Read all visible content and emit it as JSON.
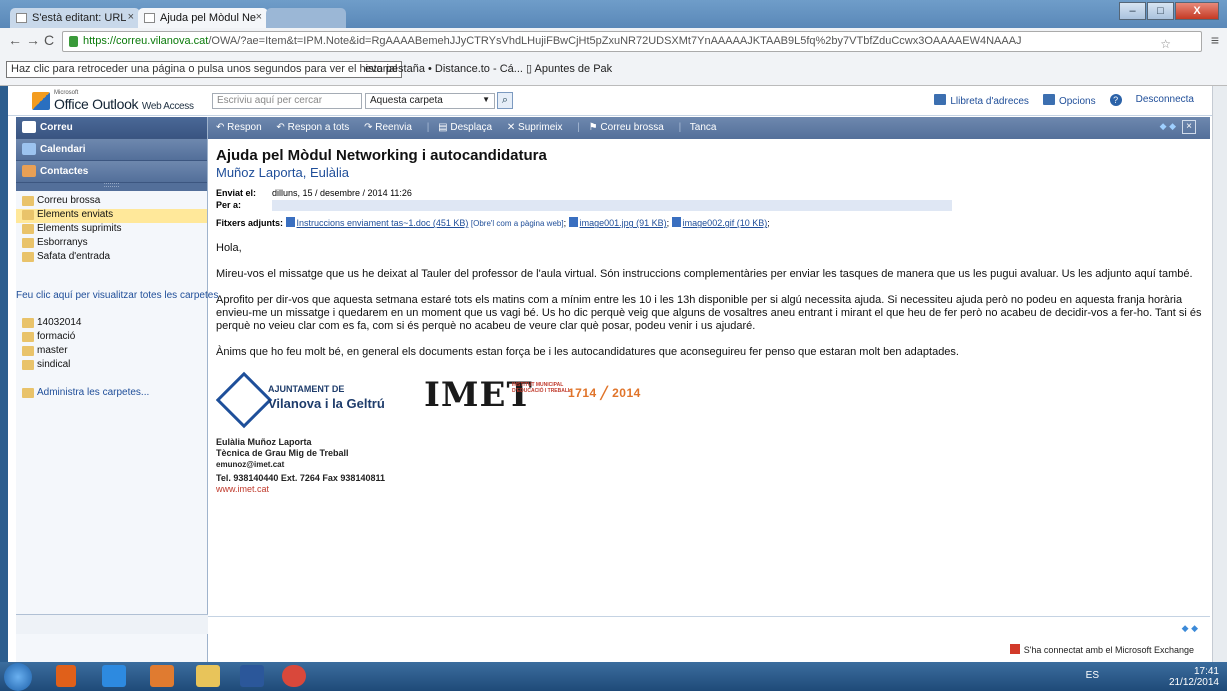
{
  "browser": {
    "tabs": [
      {
        "label": "S'està editant: URL"
      },
      {
        "label": "Ajuda pel Mòdul Ne"
      }
    ],
    "url_host": "https://correu.vilanova.cat",
    "url_path": "/OWA/?ae=Item&t=IPM.Note&id=RgAAAABemehJJyCTRYsVhdLHujiFBwCjHt5pZxuNR72UDSXMt7YnAAAAAJKTAAB9L5fq%2by7VTbfZduCcwx3OAAAAEW4NAAAJ",
    "tooltip": "Haz clic para retroceder una página o pulsa unos segundos para ver el historial",
    "bookmarks": "eva pestaña  •  Distance.to - Cá...  ▯ Apuntes de Pak"
  },
  "owa": {
    "brand_ms": "Microsoft",
    "brand_name": "Office Outlook",
    "brand_sub": "Web Access",
    "search_placeholder": "Escriviu aquí per cercar",
    "search_scope": "Aquesta carpeta",
    "header_links": {
      "address_book": "Llibreta d'adreces",
      "options": "Opcions",
      "logout": "Desconnecta"
    },
    "nav": {
      "mail": "Correu",
      "calendar": "Calendari",
      "contacts": "Contactes"
    },
    "folders": [
      {
        "label": "Correu brossa"
      },
      {
        "label": "Elements enviats"
      },
      {
        "label": "Elements suprimits"
      },
      {
        "label": "Esborranys"
      },
      {
        "label": "Safata d'entrada"
      }
    ],
    "show_all_folders": "Feu clic aquí per visualitzar totes les carpetes",
    "custom_folders": [
      {
        "label": "14032014"
      },
      {
        "label": "formació"
      },
      {
        "label": "master"
      },
      {
        "label": "sindical"
      }
    ],
    "manage_folders": "Administra les carpetes...",
    "toolbar": {
      "reply": "Respon",
      "reply_all": "Respon a tots",
      "forward": "Reenvia",
      "move": "Desplaça",
      "delete": "Suprimeix",
      "junk": "Correu brossa",
      "close": "Tanca"
    },
    "message": {
      "subject": "Ajuda pel Mòdul Networking i autocandidatura",
      "sender": "Muñoz Laporta, Eulàlia",
      "sent_label": "Enviat el:",
      "sent_value": "dilluns, 15 / desembre / 2014 11:26",
      "to_label": "Per a:",
      "attach_label": "Fitxers adjunts:",
      "attach1": "Instruccions enviament tas~1.doc (451 KB)",
      "attach1_open": "[Obre'l com a pàgina web]",
      "attach2": "image001.jpg (91 KB)",
      "attach3": "image002.gif (10 KB)",
      "greeting": "Hola,",
      "p1": "Mireu-vos el missatge que us he deixat al Tauler del professor de l'aula virtual. Són instruccions complementàries per enviar les tasques de manera que us les pugui avaluar. Us les adjunto aquí també.",
      "p2": "Aprofito per dir-vos que aquesta setmana estaré tots els matins com a mínim entre les 10 i les 13h disponible per si algú necessita ajuda. Si necessiteu ajuda però no podeu en aquesta franja horària envieu-me un missatge i quedarem en un moment que us vagi bé. Us ho dic perquè veig que alguns de vosaltres aneu entrant i mirant el que heu de fer però no acabeu de decidir-vos a fer-ho. Tant si és perquè no veieu clar com es fa, com si és perquè no acabeu de veure clar què posar, podeu venir  i us ajudaré.",
      "p3": "Ànims que ho feu molt bé, en general els documents estan força be i les autocandidatures que aconseguireu fer penso que estaran molt ben adaptades."
    },
    "logos": {
      "ajuntament_top": "AJUNTAMENT DE",
      "ajuntament_name": "Vilanova i la Geltrú",
      "imet": "IMET",
      "imet_sub": "INSTITUT MUNICIPAL D'EDUCACIÓ I TREBALL",
      "year_from": "1714",
      "year_to": "2014"
    },
    "signature": {
      "name": "Eulàlia Muñoz Laporta",
      "role": "Tècnica de Grau Mig de Treball",
      "email": "emunoz@imet.cat",
      "phone": "Tel. 938140440  Ext. 7264  Fax 938140811",
      "web": "www.imet.cat"
    },
    "status": "S'ha connectat amb el Microsoft Exchange"
  },
  "taskbar": {
    "lang": "ES",
    "time": "17:41",
    "date": "21/12/2014"
  }
}
